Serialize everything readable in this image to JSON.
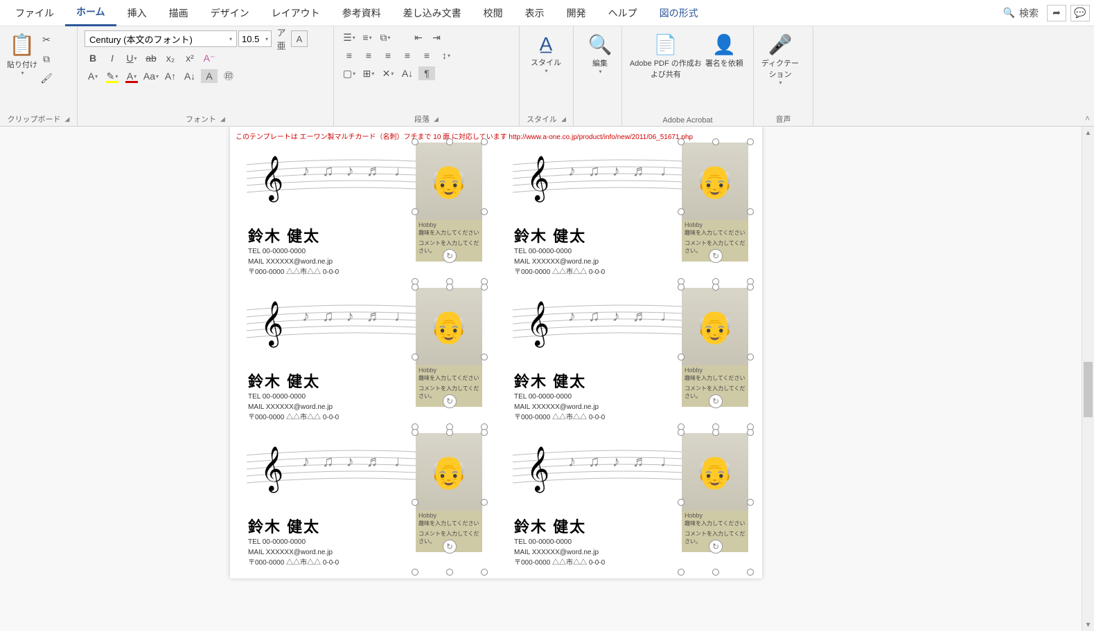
{
  "tabs": {
    "file": "ファイル",
    "home": "ホーム",
    "insert": "挿入",
    "draw": "描画",
    "design": "デザイン",
    "layout": "レイアウト",
    "references": "参考資料",
    "mailings": "差し込み文書",
    "review": "校閲",
    "view": "表示",
    "developer": "開発",
    "help": "ヘルプ",
    "pictureformat": "図の形式"
  },
  "search_label": "検索",
  "ribbon": {
    "clipboard": {
      "paste": "貼り付け",
      "group": "クリップボード"
    },
    "font": {
      "name": "Century (本文のフォント)",
      "size": "10.5",
      "group": "フォント"
    },
    "paragraph": {
      "group": "段落"
    },
    "styles": {
      "label": "スタイル",
      "group": "スタイル"
    },
    "editing": {
      "label": "編集"
    },
    "acrobat": {
      "pdf": "Adobe PDF の作成および共有",
      "sign": "署名を依頼",
      "group": "Adobe Acrobat"
    },
    "dictate": {
      "label": "ディクテーション",
      "group": "音声"
    }
  },
  "doc": {
    "banner": "このテンプレートは エーワン製マルチカード（名刺）フチまで 10 面 に対応しています http://www.a-one.co.jp/product/info/new/2011/06_51671.php",
    "card": {
      "name": "鈴木 健太",
      "tel": "TEL 00-0000-0000",
      "mail": "MAIL XXXXXX@word.ne.jp",
      "addr": "〒000-0000  △△市△△ 0-0-0",
      "hobby_label": "Hobby",
      "hobby_hint": "趣味を入力してください",
      "comment_hint": "コメントを入力してください。"
    }
  }
}
